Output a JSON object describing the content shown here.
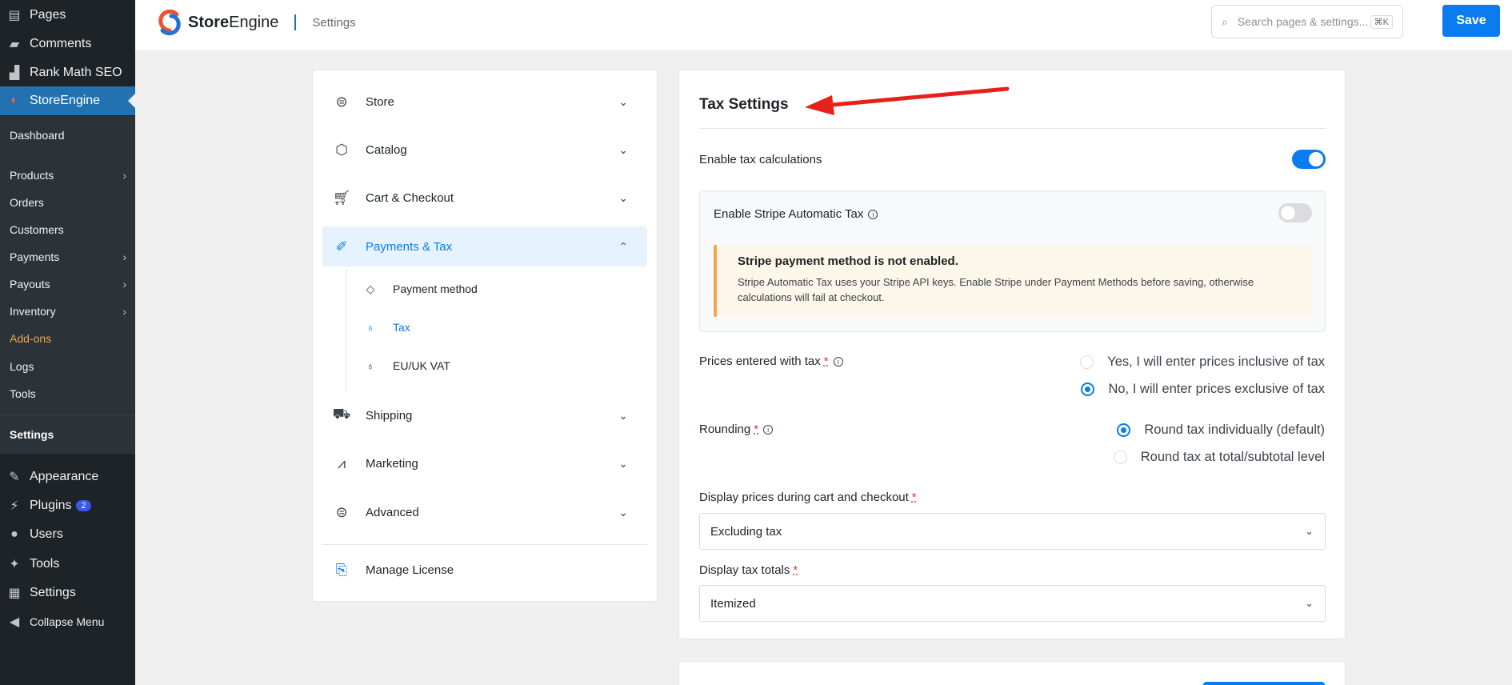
{
  "wp_menu": {
    "items": [
      {
        "label": "Pages",
        "icon": "pages-icon"
      },
      {
        "label": "Comments",
        "icon": "comments-icon"
      },
      {
        "label": "Rank Math SEO",
        "icon": "rank-math-icon"
      },
      {
        "label": "StoreEngine",
        "icon": "storeengine-icon"
      }
    ],
    "submenu": [
      {
        "label": "Dashboard"
      },
      {
        "label": "Products",
        "has_children": true
      },
      {
        "label": "Orders"
      },
      {
        "label": "Customers"
      },
      {
        "label": "Payments",
        "has_children": true
      },
      {
        "label": "Payouts",
        "has_children": true
      },
      {
        "label": "Inventory",
        "has_children": true
      },
      {
        "label": "Add-ons"
      },
      {
        "label": "Logs"
      },
      {
        "label": "Tools"
      },
      {
        "label": "Settings"
      }
    ],
    "bottom_items": [
      {
        "label": "Appearance",
        "icon": "appearance-icon"
      },
      {
        "label": "Plugins",
        "icon": "plugins-icon",
        "badge": "2"
      },
      {
        "label": "Users",
        "icon": "users-icon"
      },
      {
        "label": "Tools",
        "icon": "tools-icon"
      },
      {
        "label": "Settings",
        "icon": "settings-icon"
      },
      {
        "label": "Collapse Menu",
        "icon": "collapse-icon"
      }
    ]
  },
  "header": {
    "brand_bold": "Store",
    "brand_light": "Engine",
    "breadcrumb": "Settings",
    "search_placeholder": "Search pages & settings...",
    "search_shortcut": "⌘K",
    "save_label": "Save"
  },
  "settings_nav": {
    "items": [
      {
        "label": "Store"
      },
      {
        "label": "Catalog"
      },
      {
        "label": "Cart & Checkout"
      },
      {
        "label": "Payments & Tax"
      },
      {
        "label": "Shipping"
      },
      {
        "label": "Marketing"
      },
      {
        "label": "Advanced"
      }
    ],
    "sub_items": [
      {
        "label": "Payment method"
      },
      {
        "label": "Tax"
      },
      {
        "label": "EU/UK VAT"
      }
    ],
    "license_label": "Manage License"
  },
  "tax": {
    "title": "Tax Settings",
    "enable_label": "Enable tax calculations",
    "stripe_label": "Enable Stripe Automatic Tax",
    "alert_title": "Stripe payment method is not enabled.",
    "alert_body": "Stripe Automatic Tax uses your Stripe API keys. Enable Stripe under Payment Methods before saving, otherwise calculations will fail at checkout.",
    "prices_label": "Prices entered with tax",
    "prices_options": [
      "Yes, I will enter prices inclusive of tax",
      "No, I will enter prices exclusive of tax"
    ],
    "rounding_label": "Rounding",
    "rounding_options": [
      "Round tax individually (default)",
      "Round tax at total/subtotal level"
    ],
    "display_prices_label": "Display prices during cart and checkout",
    "display_prices_value": "Excluding tax",
    "display_totals_label": "Display tax totals",
    "display_totals_value": "Itemized"
  }
}
